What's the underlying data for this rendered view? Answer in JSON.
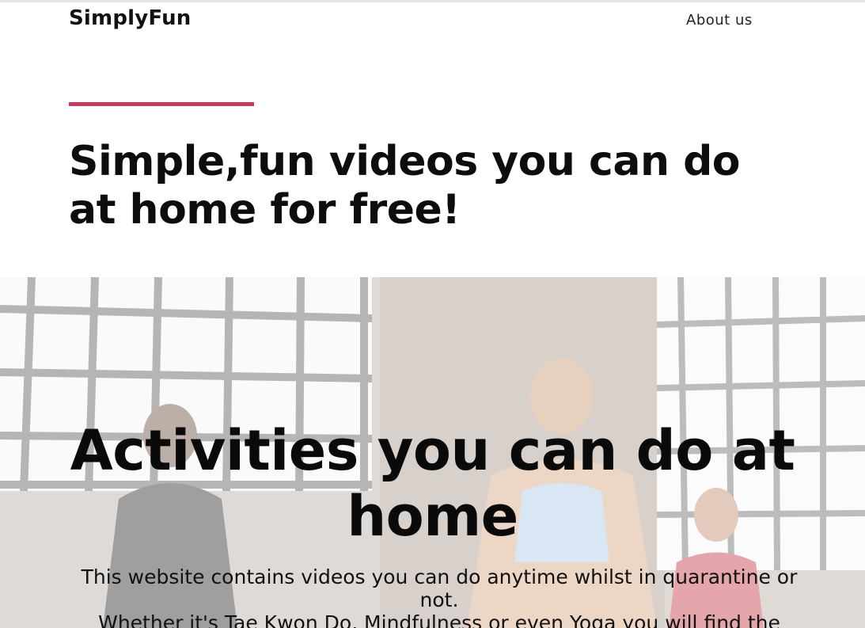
{
  "navbar": {
    "brand": "SimplyFun",
    "links": [
      {
        "label": "About us"
      }
    ]
  },
  "intro": {
    "headline": "Simple,fun videos you can do at home for free!"
  },
  "hero": {
    "title": "Activities you can do at home",
    "lines": [
      "This website contains videos you can do anytime whilst in quarantine or not.",
      "Whether it's Tae Kwon Do, Mindfulness or even Yoga you will find the"
    ]
  },
  "colors": {
    "accent": "#c8385e",
    "text": "#111111",
    "background": "#ffffff"
  }
}
